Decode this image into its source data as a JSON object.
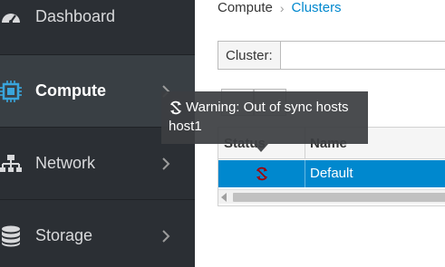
{
  "sidebar": {
    "items": [
      {
        "label": "Dashboard",
        "icon": "dashboard-icon"
      },
      {
        "label": "Compute",
        "icon": "cpu-chip-icon",
        "active": true
      },
      {
        "label": "Network",
        "icon": "network-icon"
      },
      {
        "label": "Storage",
        "icon": "database-icon"
      }
    ]
  },
  "breadcrumb": {
    "parent": "Compute",
    "current": "Clusters"
  },
  "filter": {
    "label": "Cluster:",
    "value": ""
  },
  "table": {
    "columns": [
      "Status",
      "Name"
    ],
    "rows": [
      {
        "status_icon": "out-of-sync-icon",
        "name": "Default",
        "selected": true
      }
    ]
  },
  "tooltip": {
    "line1": "Warning: Out of sync hosts",
    "line2": "host1",
    "icon": "out-of-sync-icon"
  },
  "colors": {
    "sidebar_bg": "#2b2f34",
    "sidebar_active": "#393f44",
    "accent": "#0088ce",
    "warning_icon": "#a30000"
  }
}
